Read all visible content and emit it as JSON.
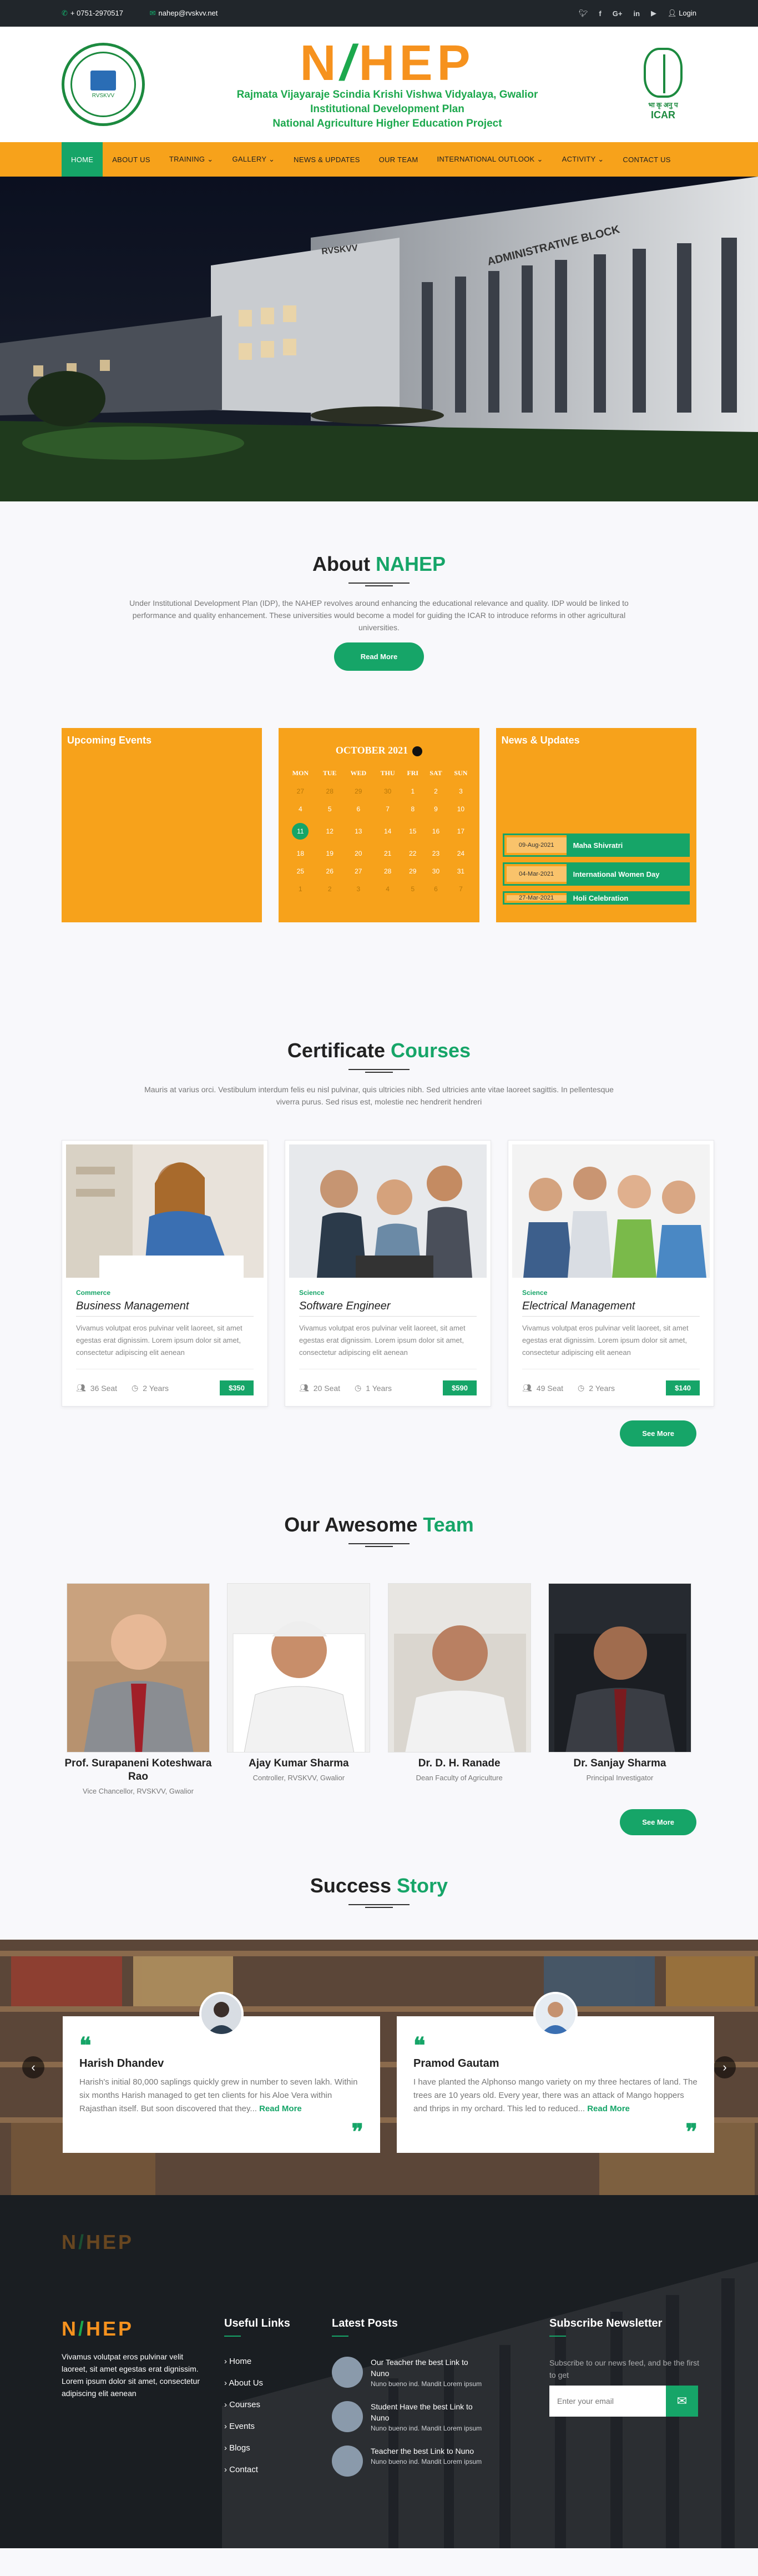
{
  "topbar": {
    "phone": "+ 0751-2970517",
    "email": "nahep@rvskvv.net",
    "social": [
      "twitter-icon",
      "facebook-icon",
      "google-plus-icon",
      "linkedin-icon",
      "youtube-icon"
    ],
    "login": "Login"
  },
  "header": {
    "logo_a": "N",
    "logo_leaf": "/",
    "logo_b": "HEP",
    "line1": "Rajmata Vijayaraje Scindia Krishi Vishwa Vidyalaya, Gwalior",
    "line2": "Institutional Development Plan",
    "line3": "National Agriculture Higher Education Project",
    "emblem_text": "RVSKVV",
    "icar": "ICAR",
    "icar_hindi": "भा कृ अनु प"
  },
  "nav": [
    "HOME",
    "ABOUT US",
    "TRAINING ⌄",
    "GALLERY ⌄",
    "NEWS & UPDATES",
    "OUR TEAM",
    "INTERNATIONAL OUTLOOK ⌄",
    "ACTIVITY ⌄",
    "CONTACT US"
  ],
  "hero": {
    "sign": "ADMINISTRATIVE BLOCK",
    "sign2": "RVSKVV"
  },
  "about": {
    "title_a": "About ",
    "title_b": "NAHEP",
    "text": "Under Institutional Development Plan (IDP), the NAHEP revolves around enhancing the educational relevance and quality. IDP would be linked to performance and quality enhancement. These universities would become a model for guiding the ICAR to introduce reforms in other agricultural universities.",
    "button": "Read More"
  },
  "widgets": {
    "events_title": "Upcoming Events",
    "news_title": "News & Updates",
    "calendar": {
      "month": "OCTOBER 2021",
      "days": [
        "MON",
        "TUE",
        "WED",
        "THU",
        "FRI",
        "SAT",
        "SUN"
      ],
      "weeks": [
        [
          "27",
          "28",
          "29",
          "30",
          "1",
          "2",
          "3"
        ],
        [
          "4",
          "5",
          "6",
          "7",
          "8",
          "9",
          "10"
        ],
        [
          "11",
          "12",
          "13",
          "14",
          "15",
          "16",
          "17"
        ],
        [
          "18",
          "19",
          "20",
          "21",
          "22",
          "23",
          "24"
        ],
        [
          "25",
          "26",
          "27",
          "28",
          "29",
          "30",
          "31"
        ],
        [
          "1",
          "2",
          "3",
          "4",
          "5",
          "6",
          "7"
        ]
      ]
    },
    "news": [
      {
        "date": "09-Aug-2021",
        "title": "Maha Shivratri"
      },
      {
        "date": "04-Mar-2021",
        "title": "International Women Day"
      },
      {
        "date": "27-Mar-2021",
        "title": "Holi Celebration"
      }
    ]
  },
  "courses": {
    "title_a": "Certificate ",
    "title_b": "Courses",
    "intro": "Mauris at varius orci. Vestibulum interdum felis eu nisl pulvinar, quis ultricies nibh. Sed ultricies ante vitae laoreet sagittis. In pellentesque viverra purus. Sed risus est, molestie nec hendrerit hendreri",
    "items": [
      {
        "cat": "Commerce",
        "name": "Business Management",
        "desc": "Vivamus volutpat eros pulvinar velit laoreet, sit amet egestas erat dignissim. Lorem ipsum dolor sit amet, consectetur adipiscing elit aenean",
        "seats": "36 Seat",
        "years": "2 Years",
        "price": "$350"
      },
      {
        "cat": "Science",
        "name": "Software Engineer",
        "desc": "Vivamus volutpat eros pulvinar velit laoreet, sit amet egestas erat dignissim. Lorem ipsum dolor sit amet, consectetur adipiscing elit aenean",
        "seats": "20 Seat",
        "years": "1 Years",
        "price": "$590"
      },
      {
        "cat": "Science",
        "name": "Electrical Management",
        "desc": "Vivamus volutpat eros pulvinar velit laoreet, sit amet egestas erat dignissim. Lorem ipsum dolor sit amet, consectetur adipiscing elit aenean",
        "seats": "49 Seat",
        "years": "2 Years",
        "price": "$140"
      }
    ],
    "button": "See More"
  },
  "team": {
    "title_a": "Our Awesome ",
    "title_b": "Team",
    "members": [
      {
        "name": "Prof. Surapaneni Koteshwara Rao",
        "role": "Vice Chancellor, RVSKVV, Gwalior"
      },
      {
        "name": "Ajay Kumar Sharma",
        "role": "Controller, RVSKVV, Gwalior"
      },
      {
        "name": "Dr. D. H. Ranade",
        "role": "Dean Faculty of Agriculture"
      },
      {
        "name": "Dr. Sanjay Sharma",
        "role": "Principal Investigator"
      }
    ],
    "button": "See More"
  },
  "stories": {
    "title_a": "Success ",
    "title_b": "Story",
    "items": [
      {
        "name": "Harish Dhandev",
        "text": "Harish's initial 80,000 saplings quickly grew in number to seven lakh. Within six months Harish managed to get ten clients for his Aloe Vera within Rajasthan itself. But soon discovered that they...",
        "more": "Read More"
      },
      {
        "name": "Pramod Gautam",
        "text": "I have planted the Alphonso mango variety on my three hectares of land. The trees are 10 years old. Every year, there was an attack of Mango hoppers and thrips in my orchard. This led to reduced...",
        "more": "Read More"
      }
    ]
  },
  "footer": {
    "about": "Vivamus volutpat eros pulvinar velit laoreet, sit amet egestas erat dignissim. Lorem ipsum dolor sit amet, consectetur adipiscing elit aenean",
    "links_title": "Useful Links",
    "links": [
      "Home",
      "About Us",
      "Courses",
      "Events",
      "Blogs",
      "Contact"
    ],
    "posts_title": "Latest Posts",
    "posts": [
      {
        "title": "Our Teacher the best Link to Nuno",
        "date": "Nuno bueno ind. Mandit Lorem ipsum"
      },
      {
        "title": "Student Have the best Link to Nuno",
        "date": "Nuno bueno ind. Mandit Lorem ipsum"
      },
      {
        "title": "Teacher the best Link to Nuno",
        "date": "Nuno bueno ind. Mandit Lorem ipsum"
      }
    ],
    "newsletter_title": "Subscribe Newsletter",
    "newsletter_text": "Subscribe to our news feed, and be the first to get",
    "email_placeholder": "Enter your email"
  }
}
